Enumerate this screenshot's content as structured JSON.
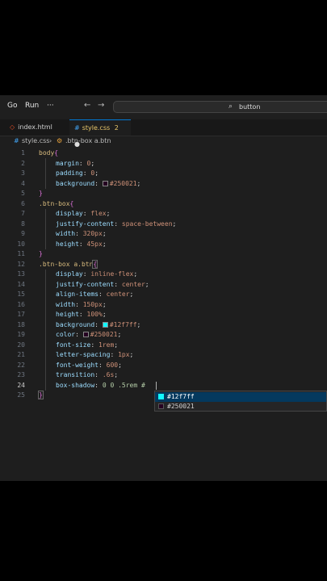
{
  "menubar": {
    "go": "Go",
    "run": "Run",
    "more": "···",
    "search_text": "button"
  },
  "tabs": [
    {
      "label": "index.html",
      "modified": ""
    },
    {
      "label": "style.css",
      "modified": "2"
    }
  ],
  "breadcrumb": {
    "file": "style.css",
    "selector": ".btn-box a.btn"
  },
  "code": {
    "l1": "body",
    "l2p": "margin",
    "l2v": "0",
    "l3p": "padding",
    "l3v": "0",
    "l4p": "background",
    "l4v": "#250021",
    "l6": ".btn-box",
    "l7p": "display",
    "l7v": "flex",
    "l8p": "justify-content",
    "l8v": "space-between",
    "l9p": "width",
    "l9v": "320px",
    "l10p": "height",
    "l10v": "45px",
    "l12": ".btn-box a.btn",
    "l13p": "display",
    "l13v": "inline-flex",
    "l14p": "justify-content",
    "l14v": "center",
    "l15p": "align-items",
    "l15v": "center",
    "l16p": "width",
    "l16v": "150px",
    "l17p": "height",
    "l17v": "100%",
    "l18p": "background",
    "l18v": "#12f7ff",
    "l19p": "color",
    "l19v": "#250021",
    "l20p": "font-size",
    "l20v": "1rem",
    "l21p": "letter-spacing",
    "l21v": "1px",
    "l22p": "font-weight",
    "l22v": "600",
    "l23p": "transition",
    "l23v": ".6s",
    "l24p": "box-shadow",
    "l24v": "0 0 .5rem #"
  },
  "line_numbers": [
    "1",
    "2",
    "3",
    "4",
    "5",
    "6",
    "7",
    "8",
    "9",
    "10",
    "11",
    "12",
    "13",
    "14",
    "15",
    "16",
    "17",
    "18",
    "19",
    "20",
    "21",
    "22",
    "23",
    "24",
    "25"
  ],
  "suggestions": [
    {
      "label": "#12f7ff",
      "color": "#12f7ff"
    },
    {
      "label": "#250021",
      "color": "#250021"
    }
  ],
  "colors": {
    "accent": "#0078d4",
    "swatch_cyan": "#12f7ff",
    "swatch_purple": "#250021"
  }
}
